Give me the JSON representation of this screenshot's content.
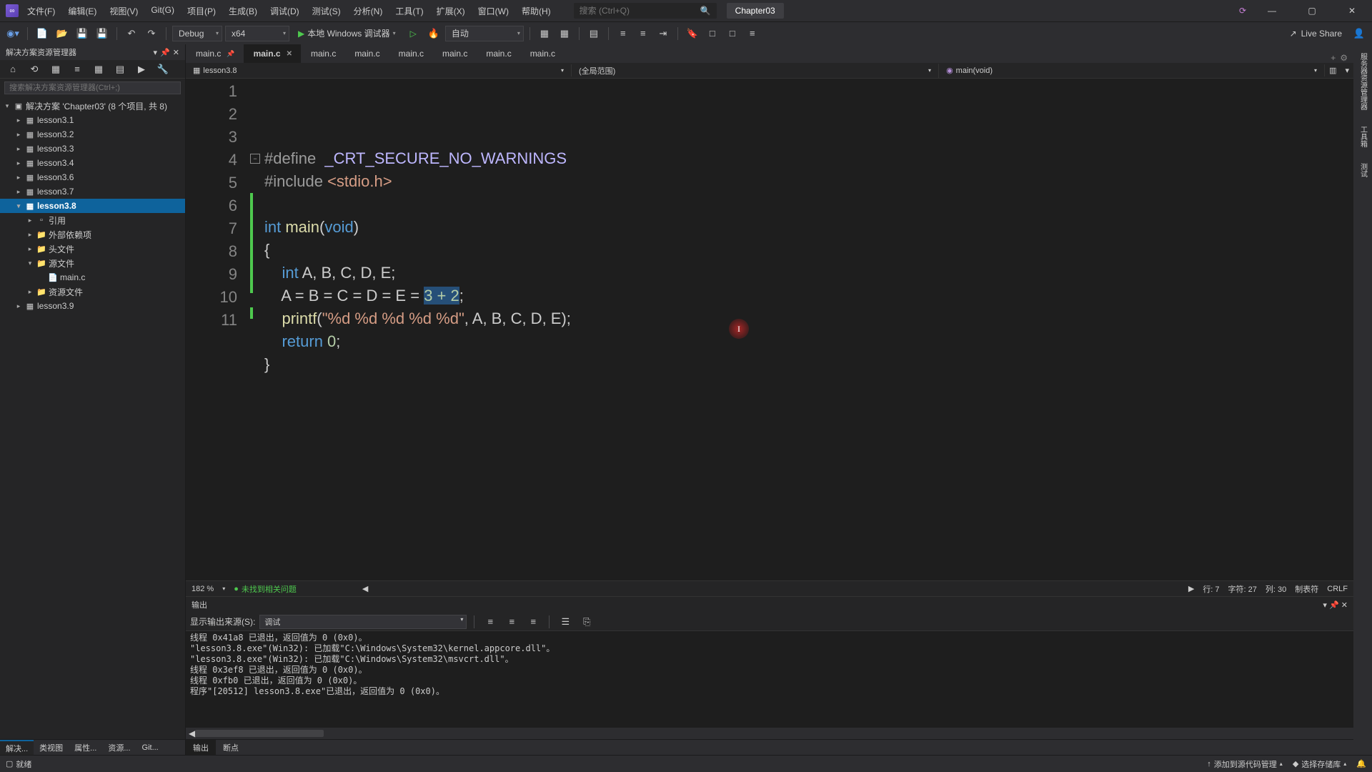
{
  "titlebar": {
    "menus": [
      "文件(F)",
      "编辑(E)",
      "视图(V)",
      "Git(G)",
      "项目(P)",
      "生成(B)",
      "调试(D)",
      "测试(S)",
      "分析(N)",
      "工具(T)",
      "扩展(X)",
      "窗口(W)",
      "帮助(H)"
    ],
    "search_placeholder": "搜索 (Ctrl+Q)",
    "project_badge": "Chapter03"
  },
  "toolbar": {
    "config": "Debug",
    "platform": "x64",
    "debug_target": "本地 Windows 调试器",
    "auto": "自动",
    "live_share": "Live Share"
  },
  "solution_explorer": {
    "title": "解决方案资源管理器",
    "search_placeholder": "搜索解决方案资源管理器(Ctrl+;)",
    "solution_label": "解决方案 'Chapter03' (8 个项目, 共 8)",
    "projects": [
      {
        "name": "lesson3.1"
      },
      {
        "name": "lesson3.2"
      },
      {
        "name": "lesson3.3"
      },
      {
        "name": "lesson3.4"
      },
      {
        "name": "lesson3.6"
      },
      {
        "name": "lesson3.7"
      }
    ],
    "active_project": "lesson3.8",
    "active_children": [
      {
        "name": "引用",
        "icon": "▫"
      },
      {
        "name": "外部依赖项",
        "icon": "📁"
      },
      {
        "name": "头文件",
        "icon": "📁"
      },
      {
        "name": "源文件",
        "icon": "📁",
        "expanded": true,
        "children": [
          {
            "name": "main.c",
            "icon": "📄"
          }
        ]
      },
      {
        "name": "资源文件",
        "icon": "📁"
      }
    ],
    "last_project": "lesson3.9",
    "bottom_tabs": [
      "解决...",
      "类视图",
      "属性...",
      "资源...",
      "Git..."
    ]
  },
  "editor": {
    "tabs": [
      {
        "label": "main.c",
        "pinned": true
      },
      {
        "label": "main.c",
        "active": true
      },
      {
        "label": "main.c"
      },
      {
        "label": "main.c"
      },
      {
        "label": "main.c"
      },
      {
        "label": "main.c"
      },
      {
        "label": "main.c"
      },
      {
        "label": "main.c"
      }
    ],
    "context_left": "lesson3.8",
    "context_mid": "(全局范围)",
    "context_right": "main(void)",
    "code_lines": [
      {
        "n": 1,
        "tokens": [
          {
            "t": "#define  ",
            "c": "kw-pre"
          },
          {
            "t": "_CRT_SECURE_NO_WARNINGS",
            "c": "kw-macro"
          }
        ]
      },
      {
        "n": 2,
        "tokens": [
          {
            "t": "#include ",
            "c": "kw-pre"
          },
          {
            "t": "<stdio.h>",
            "c": "str"
          }
        ]
      },
      {
        "n": 3,
        "tokens": []
      },
      {
        "n": 4,
        "tokens": [
          {
            "t": "int ",
            "c": "kw-type"
          },
          {
            "t": "main",
            "c": "fn-name"
          },
          {
            "t": "(",
            "c": "paren"
          },
          {
            "t": "void",
            "c": "kw-type"
          },
          {
            "t": ")",
            "c": "paren"
          }
        ],
        "fold": true
      },
      {
        "n": 5,
        "tokens": [
          {
            "t": "{",
            "c": "plain"
          }
        ]
      },
      {
        "n": 6,
        "tokens": [
          {
            "t": "    ",
            "c": "plain"
          },
          {
            "t": "int ",
            "c": "kw-type"
          },
          {
            "t": "A, B, C, D, E;",
            "c": "plain"
          }
        ],
        "changed": true
      },
      {
        "n": 7,
        "tokens": [
          {
            "t": "    A = B = C = D = E = ",
            "c": "plain"
          },
          {
            "t": "3 + 2",
            "c": "num",
            "sel": true
          },
          {
            "t": ";",
            "c": "plain"
          }
        ],
        "changed": true
      },
      {
        "n": 8,
        "tokens": [
          {
            "t": "    ",
            "c": "plain"
          },
          {
            "t": "printf",
            "c": "fn-name"
          },
          {
            "t": "(",
            "c": "paren"
          },
          {
            "t": "\"%d %d %d %d %d\"",
            "c": "str"
          },
          {
            "t": ", A, B, C, D, E);",
            "c": "plain"
          }
        ],
        "changed": true
      },
      {
        "n": 9,
        "tokens": [
          {
            "t": "    ",
            "c": "plain"
          },
          {
            "t": "return ",
            "c": "kw-blue"
          },
          {
            "t": "0",
            "c": "num"
          },
          {
            "t": ";",
            "c": "plain"
          }
        ],
        "changed": true
      },
      {
        "n": 10,
        "tokens": [
          {
            "t": "}",
            "c": "plain"
          }
        ]
      },
      {
        "n": 11,
        "tokens": [],
        "changed": true
      }
    ],
    "zoom": "182 %",
    "no_issues": "未找到相关问题",
    "line": "行: 7",
    "char": "字符: 27",
    "col": "列: 30",
    "tab": "制表符",
    "crlf": "CRLF"
  },
  "output": {
    "title": "输出",
    "source_label": "显示输出来源(S):",
    "source_value": "调试",
    "lines": [
      "线程 0x41a8 已退出，返回值为 0 (0x0)。",
      "\"lesson3.8.exe\"(Win32): 已加载\"C:\\Windows\\System32\\kernel.appcore.dll\"。",
      "\"lesson3.8.exe\"(Win32): 已加载\"C:\\Windows\\System32\\msvcrt.dll\"。",
      "线程 0x3ef8 已退出，返回值为 0 (0x0)。",
      "线程 0xfb0 已退出，返回值为 0 (0x0)。",
      "程序\"[20512] lesson3.8.exe\"已退出，返回值为 0 (0x0)。"
    ],
    "bottom_tabs": [
      "输出",
      "断点"
    ]
  },
  "statusbar": {
    "ready": "就绪",
    "source_control": "添加到源代码管理",
    "repo": "选择存储库"
  },
  "right_rail": [
    "服务器资源管理器",
    "工具箱",
    "测试"
  ]
}
